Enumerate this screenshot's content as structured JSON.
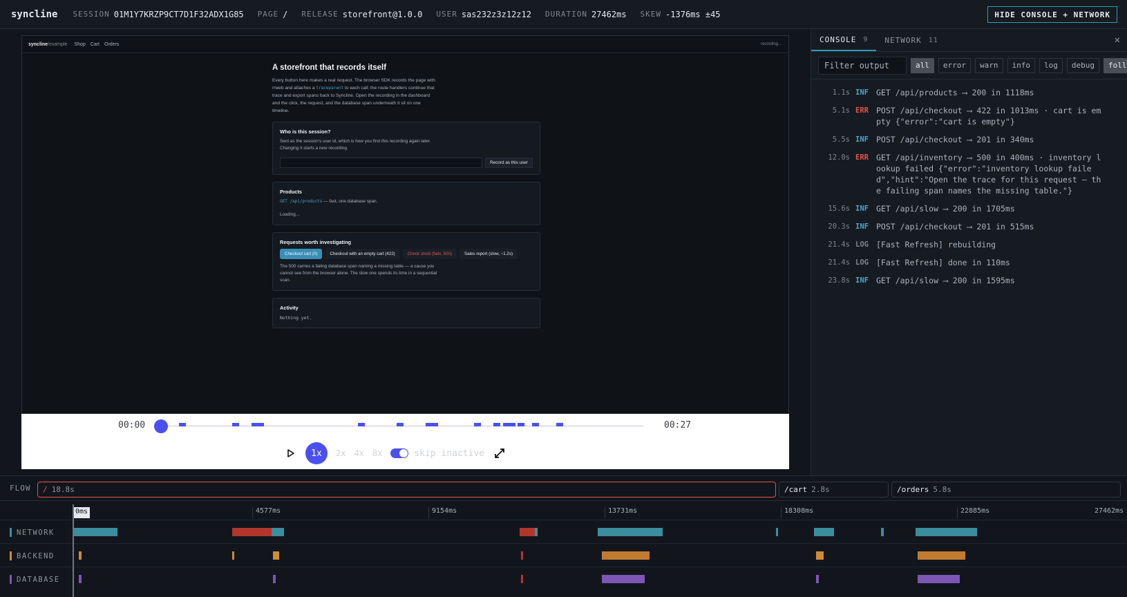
{
  "topbar": {
    "brand": "syncline",
    "session_label": "SESSION",
    "session_value": "01M1Y7KRZP9CT7D1F32ADX1G85",
    "page_label": "PAGE",
    "page_value": "/",
    "release_label": "RELEASE",
    "release_value": "storefront@1.0.0",
    "user_label": "USER",
    "user_value": "sas232z3z12z12",
    "duration_label": "DURATION",
    "duration_value": "27462ms",
    "skew_label": "SKEW",
    "skew_value": "-1376ms ±45",
    "hide_button": "HIDE CONSOLE + NETWORK"
  },
  "replay": {
    "nav": {
      "brand": "syncline",
      "brand_suffix": "/example",
      "links": [
        "Shop",
        "Cart",
        "Orders"
      ],
      "status": "recording…"
    },
    "title": "A storefront that records itself",
    "intro_a": "Every button here makes a real request. The browser SDK records the page with rrweb and attaches a ",
    "intro_code": "traceparent",
    "intro_b": " to each call; the route handlers continue that trace and export spans back to Syncline. Open the recording in the dashboard and the click, the request, and the database span underneath it sit on one timeline.",
    "who": {
      "heading": "Who is this session?",
      "text": "Sent as the session's user id, which is how you find this recording again later. Changing it starts a new recording.",
      "button": "Record as this user"
    },
    "products": {
      "heading": "Products",
      "code": "GET /api/products",
      "text": " — fast, one database span.",
      "status": "Loading…"
    },
    "investigate": {
      "heading": "Requests worth investigating",
      "buttons": [
        "Checkout cart (0)",
        "Checkout with an empty cart (422)",
        "Check stock (fails, 500)",
        "Sales report (slow, ~1.2s)"
      ],
      "text": "The 500 carries a failing database span naming a missing table — a cause you cannot see from the browser alone. The slow one spends its time in a sequential scan."
    },
    "activity": {
      "heading": "Activity",
      "text": "Nothing yet."
    }
  },
  "controls": {
    "time_start": "00:00",
    "time_end": "00:27",
    "progress": 0.0,
    "event_ticks": [
      0.04,
      0.15,
      0.19,
      0.41,
      0.49,
      0.55,
      0.65,
      0.69,
      0.71,
      0.74,
      0.77,
      0.82
    ],
    "speeds": [
      "1x",
      "2x",
      "4x",
      "8x"
    ],
    "active_speed": "1x",
    "skip_inactive": "skip inactive",
    "skip_inactive_on": true
  },
  "console": {
    "tabs": [
      {
        "label": "CONSOLE",
        "count": "9"
      },
      {
        "label": "NETWORK",
        "count": "11"
      }
    ],
    "filter_placeholder": "Filter output",
    "levels": [
      "all",
      "error",
      "warn",
      "info",
      "log",
      "debug"
    ],
    "active_level": "all",
    "follow": "follow",
    "level_colors": {
      "INF": "#4ba3c7",
      "ERR": "#e5534b",
      "LOG": "#7d8590"
    },
    "entries": [
      {
        "ts": "1.1s",
        "level": "INF",
        "msg": "GET /api/products ⟶ 200 in 1118ms"
      },
      {
        "ts": "5.1s",
        "level": "ERR",
        "msg": "POST /api/checkout ⟶ 422 in 1013ms · cart is empty {\"error\":\"cart is empty\"}"
      },
      {
        "ts": "5.5s",
        "level": "INF",
        "msg": "POST /api/checkout ⟶ 201 in 340ms"
      },
      {
        "ts": "12.0s",
        "level": "ERR",
        "msg": "GET /api/inventory ⟶ 500 in 400ms · inventory lookup failed {\"error\":\"inventory lookup failed\",\"hint\":\"Open the trace for this request — the failing span names the missing table.\"}"
      },
      {
        "ts": "15.6s",
        "level": "INF",
        "msg": "GET /api/slow ⟶ 200 in 1705ms"
      },
      {
        "ts": "20.3s",
        "level": "INF",
        "msg": "POST /api/checkout ⟶ 201 in 515ms"
      },
      {
        "ts": "21.4s",
        "level": "LOG",
        "msg": "[Fast Refresh] rebuilding"
      },
      {
        "ts": "21.4s",
        "level": "LOG",
        "msg": "[Fast Refresh] done in 110ms"
      },
      {
        "ts": "23.8s",
        "level": "INF",
        "msg": "GET /api/slow ⟶ 200 in 1595ms"
      }
    ]
  },
  "flow": {
    "label": "FLOW",
    "routes": [
      {
        "path": "/",
        "dur": "18.8s"
      },
      {
        "path": "/cart",
        "dur": "2.8s"
      },
      {
        "path": "/orders",
        "dur": "5.8s"
      }
    ]
  },
  "timeline": {
    "total_ms": 27462,
    "ticks": [
      "0ms",
      "4577ms",
      "9154ms",
      "13731ms",
      "18308ms",
      "22885ms",
      "27462ms"
    ],
    "lanes": [
      {
        "name": "NETWORK",
        "color": "#3b8e9e",
        "spans": [
          [
            0,
            1150,
            "#3b8e9e"
          ],
          [
            4150,
            1020,
            "#b3362c"
          ],
          [
            5170,
            330,
            "#3b8e9e"
          ],
          [
            11650,
            400,
            "#b3362c"
          ],
          [
            12050,
            80,
            "#3b8e9e"
          ],
          [
            13700,
            1700,
            "#3b8e9e"
          ],
          [
            18350,
            60,
            "#3b8e9e"
          ],
          [
            19350,
            520,
            "#3b8e9e"
          ],
          [
            21100,
            60,
            "#3b8e9e"
          ],
          [
            22000,
            1600,
            "#3b8e9e"
          ]
        ]
      },
      {
        "name": "BACKEND",
        "color": "#d08a38",
        "spans": [
          [
            150,
            70,
            "#d08a38"
          ],
          [
            4150,
            60,
            "#d08a38"
          ],
          [
            5220,
            150,
            "#d08a38"
          ],
          [
            11700,
            40,
            "#b3362c"
          ],
          [
            13800,
            1250,
            "#c07a30"
          ],
          [
            19400,
            200,
            "#d08a38"
          ],
          [
            22050,
            1250,
            "#c07a30"
          ]
        ]
      },
      {
        "name": "DATABASE",
        "color": "#7d56b5",
        "spans": [
          [
            150,
            70,
            "#7d56b5"
          ],
          [
            5220,
            70,
            "#7d56b5"
          ],
          [
            11700,
            40,
            "#b3362c"
          ],
          [
            13800,
            1120,
            "#7d56b5"
          ],
          [
            19400,
            70,
            "#7d56b5"
          ],
          [
            22050,
            1100,
            "#7d56b5"
          ]
        ]
      }
    ]
  }
}
